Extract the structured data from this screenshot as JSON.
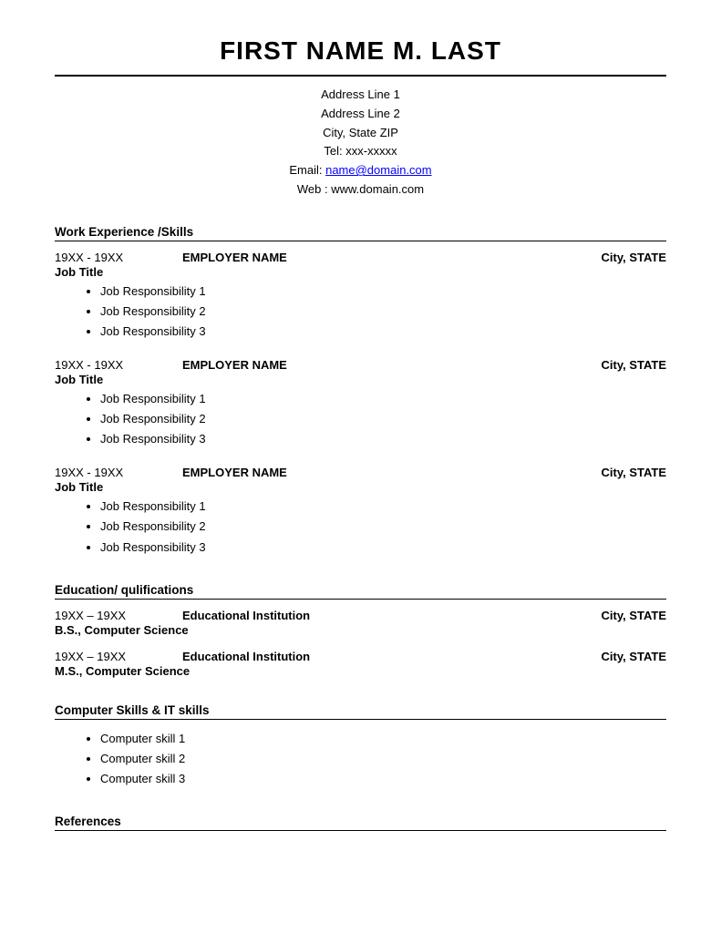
{
  "header": {
    "name": "FIRST NAME M. LAST",
    "address_line1": "Address Line 1",
    "address_line2": "Address Line 2",
    "city_state_zip": "City, State ZIP",
    "tel": "Tel: xxx-xxxxx",
    "email_label": "Email: ",
    "email_link": "name@domain.com",
    "email_href": "mailto:name@domain.com",
    "web": "Web : www.domain.com"
  },
  "sections": {
    "work_experience": {
      "title": "Work Experience /Skills",
      "jobs": [
        {
          "dates": "19XX - 19XX",
          "employer": "EMPLOYER NAME",
          "city": "City, STATE",
          "title": "Job Title",
          "responsibilities": [
            "Job Responsibility 1",
            "Job Responsibility 2",
            "Job Responsibility 3"
          ]
        },
        {
          "dates": "19XX - 19XX",
          "employer": "EMPLOYER NAME",
          "city": "City, STATE",
          "title": "Job Title",
          "responsibilities": [
            "Job Responsibility 1",
            "Job Responsibility 2",
            "Job Responsibility 3"
          ]
        },
        {
          "dates": "19XX - 19XX",
          "employer": "EMPLOYER NAME",
          "city": "City, STATE",
          "title": "Job Title",
          "responsibilities": [
            "Job Responsibility 1",
            "Job Responsibility 2",
            "Job Responsibility 3"
          ]
        }
      ]
    },
    "education": {
      "title": "Education/ qulifications",
      "entries": [
        {
          "dates": "19XX – 19XX",
          "institution": "Educational Institution",
          "city": "City, STATE",
          "degree": "B.S., Computer Science"
        },
        {
          "dates": "19XX – 19XX",
          "institution": "Educational Institution",
          "city": "City, STATE",
          "degree": "M.S., Computer Science"
        }
      ]
    },
    "computer_skills": {
      "title": "Computer Skills & IT skills",
      "skills": [
        "Computer skill 1",
        "Computer skill 2",
        "Computer skill 3"
      ]
    },
    "references": {
      "title": "References"
    }
  }
}
